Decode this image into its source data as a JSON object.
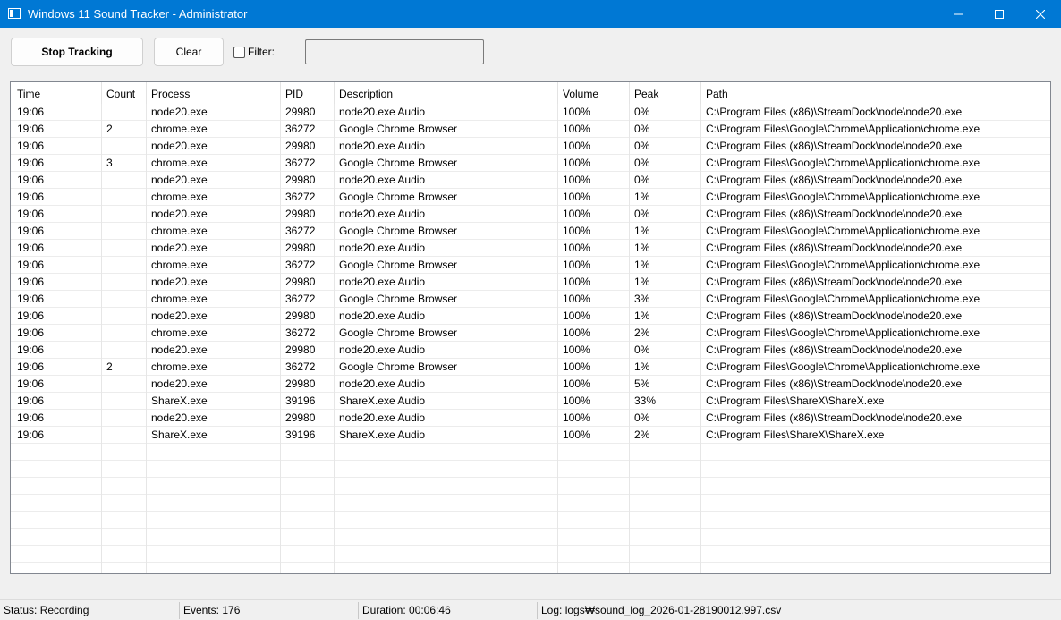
{
  "window": {
    "title": "Windows 11 Sound Tracker - Administrator",
    "accent_color": "#0078d4",
    "icons": [
      "app-window-icon",
      "minimize-icon",
      "maximize-icon",
      "close-icon"
    ]
  },
  "toolbar": {
    "stop_label": "Stop Tracking",
    "clear_label": "Clear",
    "filter_label": "Filter:",
    "filter_checked": false,
    "filter_value": ""
  },
  "table": {
    "columns": [
      "Time",
      "Count",
      "Process",
      "PID",
      "Description",
      "Volume",
      "Peak",
      "Path"
    ],
    "rows": [
      {
        "time": "19:06",
        "count": "",
        "process": "node20.exe",
        "pid": "29980",
        "description": "node20.exe Audio",
        "volume": "100%",
        "peak": "0%",
        "path": "C:\\Program Files (x86)\\StreamDock\\node\\node20.exe"
      },
      {
        "time": "19:06",
        "count": "2",
        "process": "chrome.exe",
        "pid": "36272",
        "description": "Google Chrome Browser",
        "volume": "100%",
        "peak": "0%",
        "path": "C:\\Program Files\\Google\\Chrome\\Application\\chrome.exe"
      },
      {
        "time": "19:06",
        "count": "",
        "process": "node20.exe",
        "pid": "29980",
        "description": "node20.exe Audio",
        "volume": "100%",
        "peak": "0%",
        "path": "C:\\Program Files (x86)\\StreamDock\\node\\node20.exe"
      },
      {
        "time": "19:06",
        "count": "3",
        "process": "chrome.exe",
        "pid": "36272",
        "description": "Google Chrome Browser",
        "volume": "100%",
        "peak": "0%",
        "path": "C:\\Program Files\\Google\\Chrome\\Application\\chrome.exe"
      },
      {
        "time": "19:06",
        "count": "",
        "process": "node20.exe",
        "pid": "29980",
        "description": "node20.exe Audio",
        "volume": "100%",
        "peak": "0%",
        "path": "C:\\Program Files (x86)\\StreamDock\\node\\node20.exe"
      },
      {
        "time": "19:06",
        "count": "",
        "process": "chrome.exe",
        "pid": "36272",
        "description": "Google Chrome Browser",
        "volume": "100%",
        "peak": "1%",
        "path": "C:\\Program Files\\Google\\Chrome\\Application\\chrome.exe"
      },
      {
        "time": "19:06",
        "count": "",
        "process": "node20.exe",
        "pid": "29980",
        "description": "node20.exe Audio",
        "volume": "100%",
        "peak": "0%",
        "path": "C:\\Program Files (x86)\\StreamDock\\node\\node20.exe"
      },
      {
        "time": "19:06",
        "count": "",
        "process": "chrome.exe",
        "pid": "36272",
        "description": "Google Chrome Browser",
        "volume": "100%",
        "peak": "1%",
        "path": "C:\\Program Files\\Google\\Chrome\\Application\\chrome.exe"
      },
      {
        "time": "19:06",
        "count": "",
        "process": "node20.exe",
        "pid": "29980",
        "description": "node20.exe Audio",
        "volume": "100%",
        "peak": "1%",
        "path": "C:\\Program Files (x86)\\StreamDock\\node\\node20.exe"
      },
      {
        "time": "19:06",
        "count": "",
        "process": "chrome.exe",
        "pid": "36272",
        "description": "Google Chrome Browser",
        "volume": "100%",
        "peak": "1%",
        "path": "C:\\Program Files\\Google\\Chrome\\Application\\chrome.exe"
      },
      {
        "time": "19:06",
        "count": "",
        "process": "node20.exe",
        "pid": "29980",
        "description": "node20.exe Audio",
        "volume": "100%",
        "peak": "1%",
        "path": "C:\\Program Files (x86)\\StreamDock\\node\\node20.exe"
      },
      {
        "time": "19:06",
        "count": "",
        "process": "chrome.exe",
        "pid": "36272",
        "description": "Google Chrome Browser",
        "volume": "100%",
        "peak": "3%",
        "path": "C:\\Program Files\\Google\\Chrome\\Application\\chrome.exe"
      },
      {
        "time": "19:06",
        "count": "",
        "process": "node20.exe",
        "pid": "29980",
        "description": "node20.exe Audio",
        "volume": "100%",
        "peak": "1%",
        "path": "C:\\Program Files (x86)\\StreamDock\\node\\node20.exe"
      },
      {
        "time": "19:06",
        "count": "",
        "process": "chrome.exe",
        "pid": "36272",
        "description": "Google Chrome Browser",
        "volume": "100%",
        "peak": "2%",
        "path": "C:\\Program Files\\Google\\Chrome\\Application\\chrome.exe"
      },
      {
        "time": "19:06",
        "count": "",
        "process": "node20.exe",
        "pid": "29980",
        "description": "node20.exe Audio",
        "volume": "100%",
        "peak": "0%",
        "path": "C:\\Program Files (x86)\\StreamDock\\node\\node20.exe"
      },
      {
        "time": "19:06",
        "count": "2",
        "process": "chrome.exe",
        "pid": "36272",
        "description": "Google Chrome Browser",
        "volume": "100%",
        "peak": "1%",
        "path": "C:\\Program Files\\Google\\Chrome\\Application\\chrome.exe"
      },
      {
        "time": "19:06",
        "count": "",
        "process": "node20.exe",
        "pid": "29980",
        "description": "node20.exe Audio",
        "volume": "100%",
        "peak": "5%",
        "path": "C:\\Program Files (x86)\\StreamDock\\node\\node20.exe"
      },
      {
        "time": "19:06",
        "count": "",
        "process": "ShareX.exe",
        "pid": "39196",
        "description": "ShareX.exe Audio",
        "volume": "100%",
        "peak": "33%",
        "path": "C:\\Program Files\\ShareX\\ShareX.exe"
      },
      {
        "time": "19:06",
        "count": "",
        "process": "node20.exe",
        "pid": "29980",
        "description": "node20.exe Audio",
        "volume": "100%",
        "peak": "0%",
        "path": "C:\\Program Files (x86)\\StreamDock\\node\\node20.exe"
      },
      {
        "time": "19:06",
        "count": "",
        "process": "ShareX.exe",
        "pid": "39196",
        "description": "ShareX.exe Audio",
        "volume": "100%",
        "peak": "2%",
        "path": "C:\\Program Files\\ShareX\\ShareX.exe"
      }
    ]
  },
  "status": {
    "state": "Status: Recording",
    "events": "Events: 176",
    "duration": "Duration: 00:06:46",
    "log": "Log: logs₩sound_log_2026-01-28190012.997.csv"
  }
}
